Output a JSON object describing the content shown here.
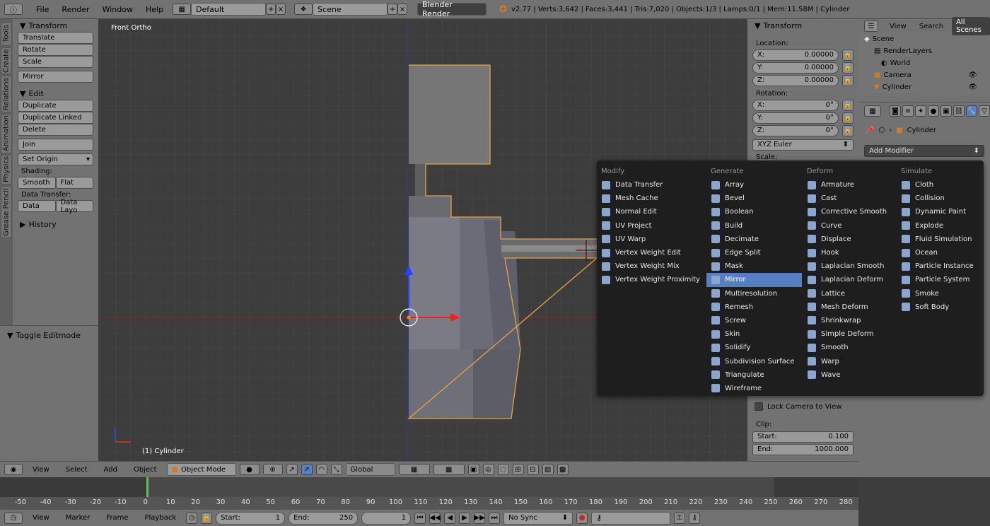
{
  "topbar": {
    "menus": [
      "File",
      "Render",
      "Window",
      "Help"
    ],
    "layout": "Default",
    "scene": "Scene",
    "engine": "Blender Render",
    "info": "v2.77 | Verts:3,642 | Faces:3,441 | Tris:7,020 | Objects:1/3 | Lamps:0/1 | Mem:11.58M | Cylinder"
  },
  "vtabs": [
    "Tools",
    "Create",
    "Relations",
    "Animation",
    "Physics",
    "Grease Pencil"
  ],
  "toolpanel": {
    "transform_title": "Transform",
    "translate": "Translate",
    "rotate": "Rotate",
    "scale": "Scale",
    "mirror": "Mirror",
    "edit_title": "Edit",
    "duplicate": "Duplicate",
    "duplicate_linked": "Duplicate Linked",
    "delete": "Delete",
    "join": "Join",
    "set_origin": "Set Origin",
    "shading_label": "Shading:",
    "smooth": "Smooth",
    "flat": "Flat",
    "data_transfer_label": "Data Transfer:",
    "data": "Data",
    "data_layo": "Data Layo",
    "history": "History",
    "toggle_editmode": "Toggle Editmode"
  },
  "viewport": {
    "view_name": "Front Ortho",
    "object_label": "(1) Cylinder"
  },
  "nprops": {
    "title": "Transform",
    "location_label": "Location:",
    "loc_x": "X:",
    "loc_x_val": "0.00000",
    "loc_y": "Y:",
    "loc_y_val": "0.00000",
    "loc_z": "Z:",
    "loc_z_val": "0.00000",
    "rotation_label": "Rotation:",
    "rot_x": "X:",
    "rot_x_val": "0°",
    "rot_y": "Y:",
    "rot_y_val": "0°",
    "rot_z": "Z:",
    "rot_z_val": "0°",
    "rot_mode": "XYZ Euler",
    "scale_label": "Scale:",
    "lock_camera": "Lock Camera to View",
    "clip_label": "Clip:",
    "clip_start": "Start:",
    "clip_start_val": "0.100",
    "clip_end": "End:",
    "clip_end_val": "1000.000"
  },
  "outliner": {
    "view": "View",
    "search": "Search",
    "all_scenes": "All Scenes",
    "items": [
      "Scene",
      "RenderLayers",
      "World",
      "Camera",
      "Cylinder"
    ]
  },
  "properties": {
    "object_name": "Cylinder",
    "add_modifier": "Add Modifier"
  },
  "menu": {
    "modify_title": "Modify",
    "modify": [
      "Data Transfer",
      "Mesh Cache",
      "Normal Edit",
      "UV Project",
      "UV Warp",
      "Vertex Weight Edit",
      "Vertex Weight Mix",
      "Vertex Weight Proximity"
    ],
    "generate_title": "Generate",
    "generate": [
      "Array",
      "Bevel",
      "Boolean",
      "Build",
      "Decimate",
      "Edge Split",
      "Mask",
      "Mirror",
      "Multiresolution",
      "Remesh",
      "Screw",
      "Skin",
      "Solidify",
      "Subdivision Surface",
      "Triangulate",
      "Wireframe"
    ],
    "deform_title": "Deform",
    "deform": [
      "Armature",
      "Cast",
      "Corrective Smooth",
      "Curve",
      "Displace",
      "Hook",
      "Laplacian Smooth",
      "Laplacian Deform",
      "Lattice",
      "Mesh Deform",
      "Shrinkwrap",
      "Simple Deform",
      "Smooth",
      "Warp",
      "Wave"
    ],
    "simulate_title": "Simulate",
    "simulate": [
      "Cloth",
      "Collision",
      "Dynamic Paint",
      "Explode",
      "Fluid Simulation",
      "Ocean",
      "Particle Instance",
      "Particle System",
      "Smoke",
      "Soft Body"
    ]
  },
  "viewheader": {
    "view": "View",
    "select": "Select",
    "add": "Add",
    "object": "Object",
    "mode": "Object Mode",
    "orientation": "Global"
  },
  "timeline": {
    "ticks": [
      "-50",
      "-40",
      "-30",
      "-20",
      "-10",
      "0",
      "10",
      "20",
      "30",
      "40",
      "50",
      "60",
      "70",
      "80",
      "90",
      "100",
      "110",
      "120",
      "130",
      "140",
      "150",
      "160",
      "170",
      "180",
      "190",
      "200",
      "210",
      "220",
      "230",
      "240",
      "250",
      "260",
      "270",
      "280"
    ]
  },
  "tlheader": {
    "view": "View",
    "marker": "Marker",
    "frame": "Frame",
    "playback": "Playback",
    "start_label": "Start:",
    "start_val": "1",
    "end_label": "End:",
    "end_val": "250",
    "current": "1",
    "sync": "No Sync"
  }
}
